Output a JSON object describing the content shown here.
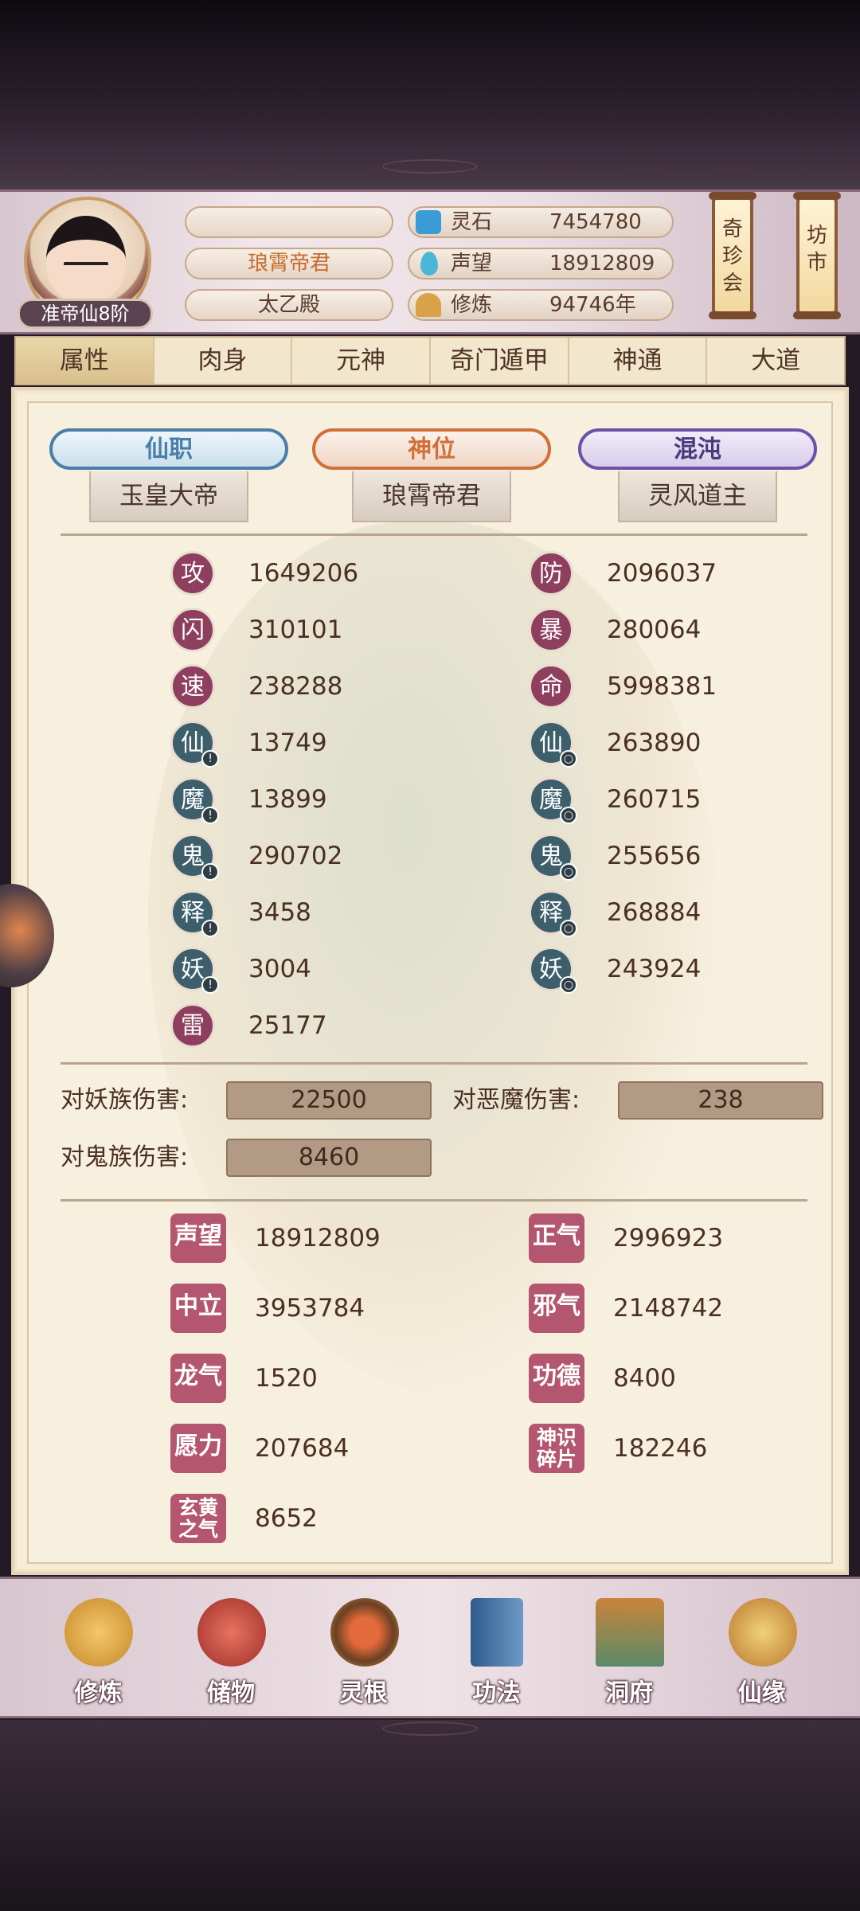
{
  "header": {
    "rank": "准帝仙8阶",
    "name_row1": "",
    "title": "琅霄帝君",
    "hall": "太乙殿",
    "resources": [
      {
        "icon": "spirit-stone-icon",
        "label": "灵石",
        "value": "7454780",
        "color": "#3a9bd6"
      },
      {
        "icon": "prestige-icon",
        "label": "声望",
        "value": "18912809",
        "color": "#4ab6d8"
      },
      {
        "icon": "cultivation-icon",
        "label": "修炼",
        "value": "94746年",
        "color": "#d9a14a"
      }
    ],
    "shop_buttons": [
      "奇珍会",
      "坊市"
    ]
  },
  "tabs": [
    "属性",
    "肉身",
    "元神",
    "奇门遁甲",
    "神通",
    "大道"
  ],
  "titles": {
    "xianzhi": {
      "label": "仙职",
      "value": "玉皇大帝",
      "color": "#4a7ea8"
    },
    "shenwei": {
      "label": "神位",
      "value": "琅霄帝君",
      "color": "#d0703a"
    },
    "hundun": {
      "label": "混沌",
      "value": "灵风道主",
      "color": "#6a52a8"
    }
  },
  "stats_left": [
    {
      "char": "攻",
      "value": "1649206",
      "style": "red",
      "mark": ""
    },
    {
      "char": "闪",
      "value": "310101",
      "style": "red",
      "mark": ""
    },
    {
      "char": "速",
      "value": "238288",
      "style": "red",
      "mark": ""
    },
    {
      "char": "仙",
      "value": "13749",
      "style": "teal",
      "mark": "!"
    },
    {
      "char": "魔",
      "value": "13899",
      "style": "teal",
      "mark": "!"
    },
    {
      "char": "鬼",
      "value": "290702",
      "style": "teal",
      "mark": "!"
    },
    {
      "char": "释",
      "value": "3458",
      "style": "teal",
      "mark": "!"
    },
    {
      "char": "妖",
      "value": "3004",
      "style": "teal",
      "mark": "!"
    },
    {
      "char": "雷",
      "value": "25177",
      "style": "red",
      "mark": ""
    }
  ],
  "stats_right": [
    {
      "char": "防",
      "value": "2096037",
      "style": "red",
      "mark": ""
    },
    {
      "char": "暴",
      "value": "280064",
      "style": "red",
      "mark": ""
    },
    {
      "char": "命",
      "value": "5998381",
      "style": "red",
      "mark": ""
    },
    {
      "char": "仙",
      "value": "263890",
      "style": "teal",
      "mark": "○"
    },
    {
      "char": "魔",
      "value": "260715",
      "style": "teal",
      "mark": "○"
    },
    {
      "char": "鬼",
      "value": "255656",
      "style": "teal",
      "mark": "○"
    },
    {
      "char": "释",
      "value": "268884",
      "style": "teal",
      "mark": "○"
    },
    {
      "char": "妖",
      "value": "243924",
      "style": "teal",
      "mark": "○"
    }
  ],
  "damage": [
    {
      "label": "对妖族伤害:",
      "value": "22500"
    },
    {
      "label": "对恶魔伤害:",
      "value": "238"
    },
    {
      "label": "对鬼族伤害:",
      "value": "8460"
    }
  ],
  "reputation_left": [
    {
      "label": "声望",
      "value": "18912809"
    },
    {
      "label": "中立",
      "value": "3953784"
    },
    {
      "label": "龙气",
      "value": "1520"
    },
    {
      "label": "愿力",
      "value": "207684"
    },
    {
      "label": "玄黄之气",
      "value": "8652"
    }
  ],
  "reputation_right": [
    {
      "label": "正气",
      "value": "2996923"
    },
    {
      "label": "邪气",
      "value": "2148742"
    },
    {
      "label": "功德",
      "value": "8400"
    },
    {
      "label": "神识碎片",
      "value": "182246"
    }
  ],
  "nav": [
    {
      "label": "修炼",
      "icon": "cultivate-icon",
      "color": "#d49b3a"
    },
    {
      "label": "储物",
      "icon": "storage-bag-icon",
      "color": "#c0463e"
    },
    {
      "label": "灵根",
      "icon": "spirit-root-icon",
      "color": "#7a4a2e"
    },
    {
      "label": "功法",
      "icon": "technique-book-icon",
      "color": "#3d6aa0"
    },
    {
      "label": "洞府",
      "icon": "cave-house-icon",
      "color": "#5a8a6a"
    },
    {
      "label": "仙缘",
      "icon": "fate-gourd-icon",
      "color": "#c9903a"
    }
  ]
}
